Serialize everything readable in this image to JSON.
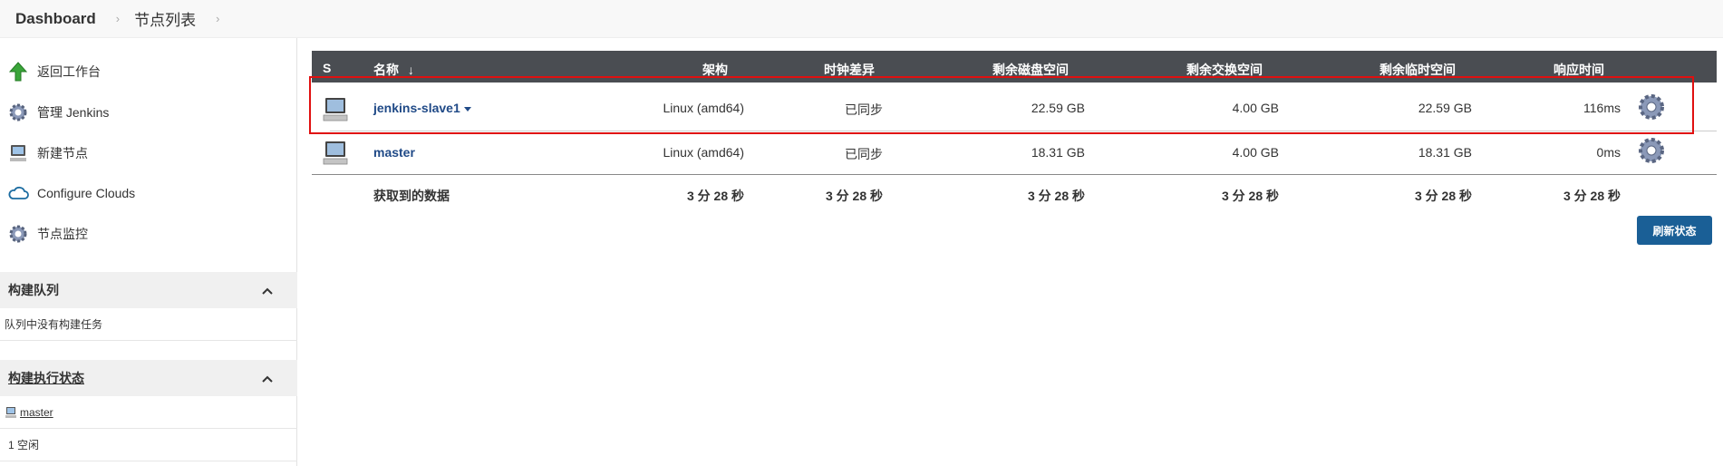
{
  "breadcrumb": {
    "items": [
      "Dashboard",
      "节点列表"
    ]
  },
  "sidebar": {
    "tasks": [
      {
        "label": "返回工作台",
        "icon": "up-arrow-icon"
      },
      {
        "label": "管理 Jenkins",
        "icon": "gear-icon"
      },
      {
        "label": "新建节点",
        "icon": "computer-icon"
      },
      {
        "label": "Configure Clouds",
        "icon": "cloud-icon"
      },
      {
        "label": "节点监控",
        "icon": "gear-icon"
      }
    ],
    "build_queue": {
      "title": "构建队列",
      "empty_text": "队列中没有构建任务"
    },
    "executor_status": {
      "title": "构建执行状态",
      "node": "master",
      "executor": "1  空闲"
    }
  },
  "table": {
    "headers": {
      "s": "S",
      "name": "名称",
      "sort": "↓",
      "arch": "架构",
      "clock": "时钟差异",
      "disk": "剩余磁盘空间",
      "swap": "剩余交换空间",
      "temp": "剩余临时空间",
      "response": "响应时间"
    },
    "rows": [
      {
        "name": "jenkins-slave1",
        "arch": "Linux (amd64)",
        "clock": "已同步",
        "disk": "22.59 GB",
        "swap": "4.00 GB",
        "temp": "22.59 GB",
        "response": "116ms"
      },
      {
        "name": "master",
        "arch": "Linux (amd64)",
        "clock": "已同步",
        "disk": "18.31 GB",
        "swap": "4.00 GB",
        "temp": "18.31 GB",
        "response": "0ms"
      }
    ],
    "totals": {
      "label": "获取到的数据",
      "arch": "3 分 28 秒",
      "clock": "3 分 28 秒",
      "disk": "3 分 28 秒",
      "swap": "3 分 28 秒",
      "temp": "3 分 28 秒",
      "response": "3 分 28 秒"
    }
  },
  "refresh_label": "刷新状态",
  "colors": {
    "header_bg": "#4a4d52",
    "link": "#204a87",
    "button": "#1a5f96",
    "highlight": "#e01010"
  }
}
